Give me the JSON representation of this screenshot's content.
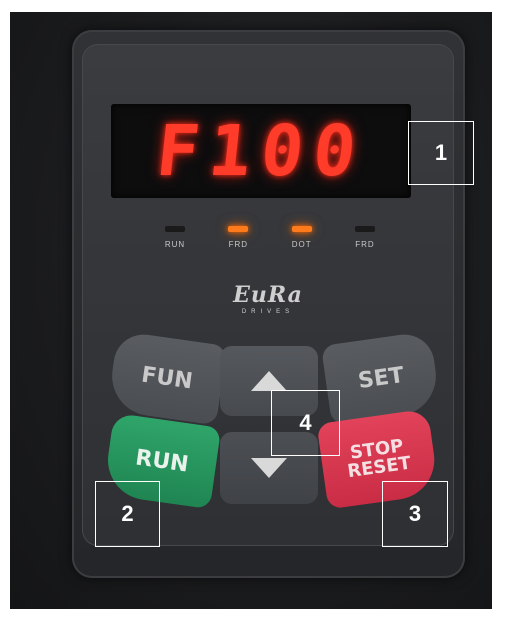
{
  "display": {
    "text": "F100"
  },
  "leds": [
    {
      "label": "RUN",
      "on": false
    },
    {
      "label": "FRD",
      "on": true
    },
    {
      "label": "DOT",
      "on": true
    },
    {
      "label": "FRD",
      "on": false
    }
  ],
  "logo": {
    "main": "EuRa",
    "sub": "DRIVES"
  },
  "buttons": {
    "fun_label": "FUN",
    "set_label": "SET",
    "run_label": "RUN",
    "stop_label_line1": "STOP",
    "stop_label_line2": "RESET",
    "up_icon": "arrow-up-icon",
    "down_icon": "arrow-down-icon"
  },
  "callouts": [
    "1",
    "2",
    "3",
    "4"
  ],
  "colors": {
    "display_red": "#ff3b2a",
    "led_orange": "#ff7a1a",
    "run_green": "#2fa56a",
    "stop_red": "#e2435a"
  }
}
